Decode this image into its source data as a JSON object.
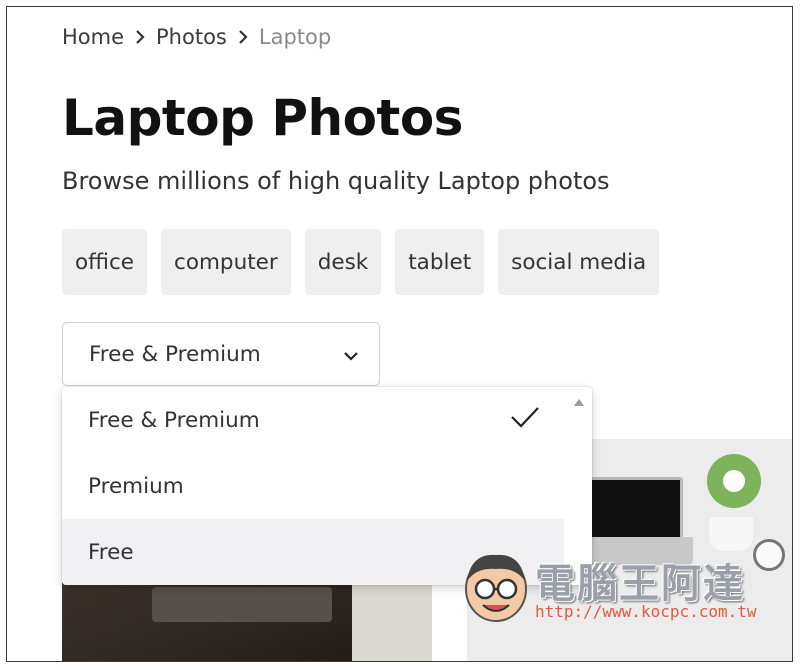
{
  "breadcrumb": {
    "items": [
      "Home",
      "Photos",
      "Laptop"
    ]
  },
  "page": {
    "title": "Laptop Photos",
    "subtitle": "Browse millions of high quality Laptop photos"
  },
  "tags": [
    "office",
    "computer",
    "desk",
    "tablet",
    "social media"
  ],
  "license_filter": {
    "selected": "Free & Premium",
    "options": [
      "Free & Premium",
      "Premium",
      "Free"
    ],
    "checked_option": "Free & Premium",
    "hovered_option": "Free"
  },
  "watermark": {
    "title": "電腦王阿達",
    "url": "http://www.kocpc.com.tw"
  },
  "icons": {
    "breadcrumb_separator": "chevron-right-icon",
    "select_toggle": "chevron-down-icon",
    "selected_mark": "checkmark-icon",
    "scroll": "scroll-up-arrow-icon"
  },
  "colors": {
    "tag_background": "#efefef",
    "hover_background": "#f1f1f3",
    "text": "#333333",
    "title": "#111111",
    "muted": "#8a8a8a",
    "watermark_url": "#e25b3c"
  }
}
